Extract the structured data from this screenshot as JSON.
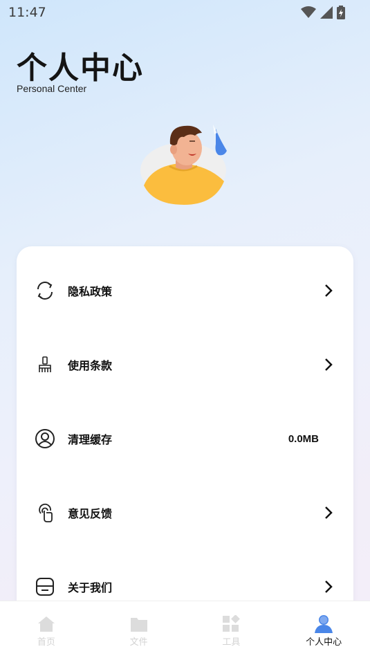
{
  "status_bar": {
    "time": "11:47"
  },
  "header": {
    "title": "个人中心",
    "subtitle": "Personal Center"
  },
  "menu": {
    "items": [
      {
        "label": "隐私政策",
        "icon": "refresh-icon",
        "action": "arrow"
      },
      {
        "label": "使用条款",
        "icon": "brush-icon",
        "action": "arrow"
      },
      {
        "label": "清理缓存",
        "icon": "user-circle-icon",
        "value": "0.0MB"
      },
      {
        "label": "意见反馈",
        "icon": "touch-icon",
        "action": "arrow"
      },
      {
        "label": "关于我们",
        "icon": "box-icon",
        "action": "arrow"
      }
    ]
  },
  "tab_bar": {
    "tabs": [
      {
        "label": "首页",
        "icon": "home-icon",
        "active": false
      },
      {
        "label": "文件",
        "icon": "folder-icon",
        "active": false
      },
      {
        "label": "工具",
        "icon": "tools-icon",
        "active": false
      },
      {
        "label": "个人中心",
        "icon": "person-icon",
        "active": true
      }
    ]
  },
  "colors": {
    "accent": "#4a86e8",
    "avatar_shirt": "#fbbd3e",
    "inactive": "#d3d3d3"
  }
}
